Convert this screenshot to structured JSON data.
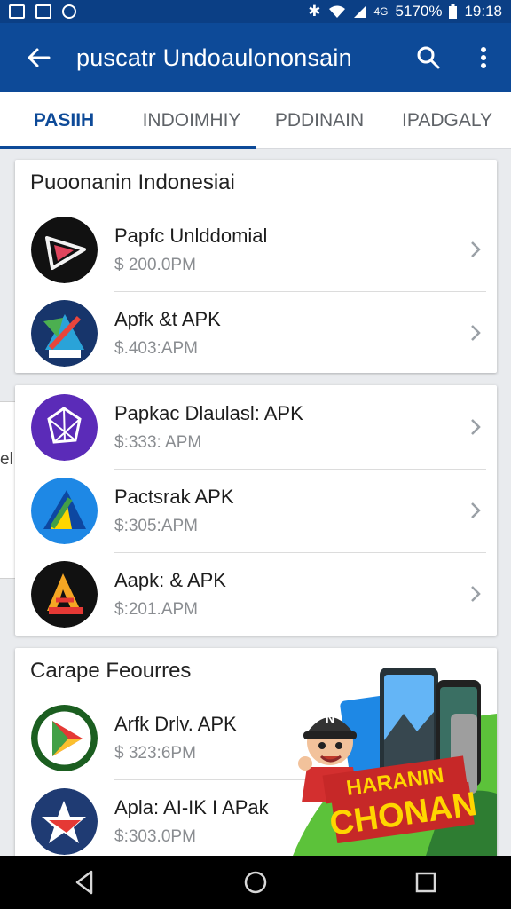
{
  "status_bar": {
    "notification_icons": [
      "gallery-icon",
      "image-icon",
      "sync-icon"
    ],
    "indicator_icons": [
      "bluetooth-icon",
      "wifi-icon",
      "signal-icon"
    ],
    "network": "4G",
    "battery": "5170%",
    "time": "19:18"
  },
  "appbar": {
    "title": "puscatr Undoaulononsain",
    "color": "#0d4a98"
  },
  "tabs": [
    {
      "label": "PASIIH",
      "active": true
    },
    {
      "label": "INDOIMHIY",
      "active": false
    },
    {
      "label": "PDDINAIN",
      "active": false
    },
    {
      "label": "IPADGALY",
      "active": false
    }
  ],
  "sections": [
    {
      "title": "Puoonanin Indonesiai",
      "items": [
        {
          "name": "Papfc Unlddomial",
          "meta": "$ 200.0PM",
          "icon": "play-arrow-icon"
        },
        {
          "name": "Apfk &t APK",
          "meta": "$.403:APM",
          "icon": "rocket-badge-icon"
        }
      ]
    },
    {
      "title": "",
      "items": [
        {
          "name": "Papkac Dlaulasl: APK",
          "meta": "$:333: APM",
          "icon": "gem-icon"
        },
        {
          "name": "Pactsrak APK",
          "meta": "$:305:APM",
          "icon": "triangle-logo-icon"
        },
        {
          "name": "Aapk: & APK",
          "meta": "$:201.APM",
          "icon": "letter-a-icon"
        }
      ]
    },
    {
      "title": "Carape Feourres",
      "items": [
        {
          "name": "Arfk Drlv. APK",
          "meta": "$ 323:6PM",
          "icon": "play-store-icon"
        },
        {
          "name": "Apla: AI-IK I APak",
          "meta": "$:303.0PM",
          "icon": "star-badge-icon"
        }
      ]
    }
  ],
  "side_fragment": "el",
  "promo": {
    "line1": "HARANIN",
    "line2": "CHONAN",
    "cap_letter": "N"
  }
}
